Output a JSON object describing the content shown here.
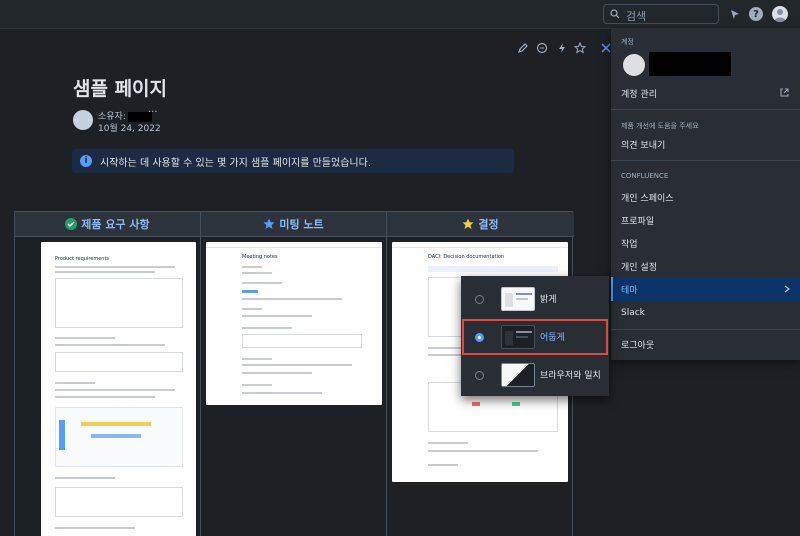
{
  "topbar": {
    "search_placeholder": "검색"
  },
  "page": {
    "title": "샘플 페이지",
    "owner_label": "소유자:",
    "more": "···",
    "date": "10월 24, 2022",
    "info": "시작하는 데 사용할 수 있는 몇 가지 샘플 페이지를 만들었습니다."
  },
  "table": {
    "columns": [
      {
        "label": "제품 요구 사항",
        "thumb_title": "Product requirements"
      },
      {
        "label": "미팅 노트",
        "thumb_title": "Meeting notes"
      },
      {
        "label": "결정",
        "thumb_title": "DACI: Decision documentation"
      }
    ]
  },
  "menu": {
    "account_section": "계정",
    "manage_account": "계정 관리",
    "feedback_section": "제품 개선에 도움을 주세요",
    "send_feedback": "의견 보내기",
    "confluence_section": "CONFLUENCE",
    "items": [
      "개인 스페이스",
      "프로파일",
      "작업",
      "개인 설정",
      "테마",
      "Slack"
    ],
    "logout": "로그아웃"
  },
  "theme_submenu": {
    "options": [
      {
        "label": "밝게",
        "selected": false
      },
      {
        "label": "어둡게",
        "selected": true
      },
      {
        "label": "브라우저와 일치",
        "selected": false
      }
    ]
  },
  "colors": {
    "accent": "#579dff",
    "menu_active": "#0c3468",
    "highlight": "#e2483d"
  }
}
